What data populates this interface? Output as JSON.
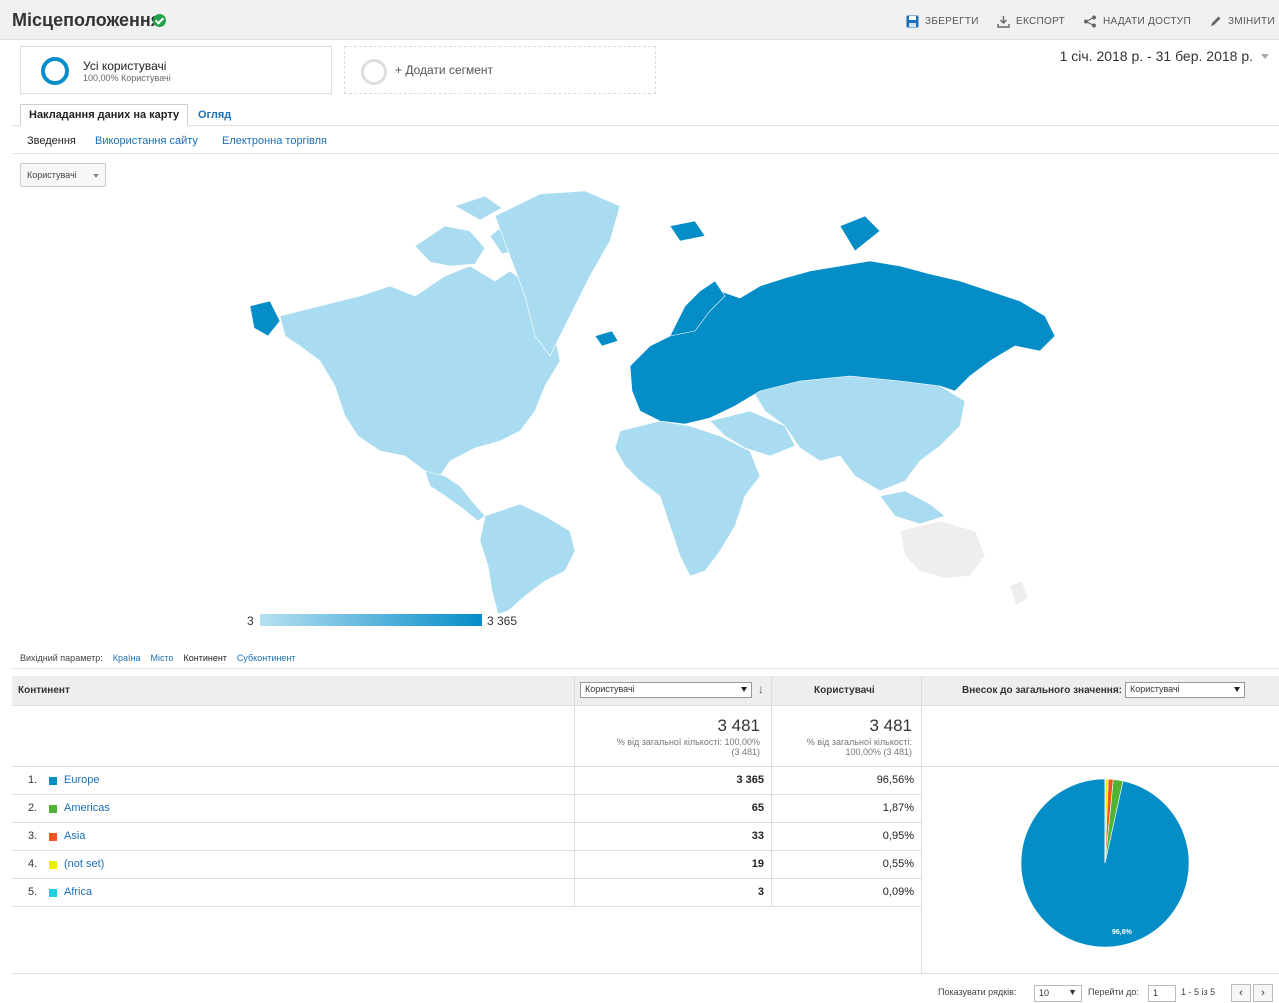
{
  "header": {
    "title": "Місцеположення",
    "save": "ЗБЕРЕГТИ",
    "export": "ЕКСПОРТ",
    "share": "НАДАТИ ДОСТУП",
    "edit": "ЗМІНИТИ"
  },
  "segments": {
    "active_title": "Усі користувачі",
    "active_sub": "100,00% Користувачі",
    "add": "+ Додати сегмент"
  },
  "date_range": "1 січ. 2018 р. - 31 бер. 2018 р.",
  "tabs": {
    "active": "Накладання даних на карту",
    "other": "Огляд"
  },
  "subtabs": [
    "Зведення",
    "Використання сайту",
    "Електронна торгівля"
  ],
  "metric_select": "Користувачі",
  "legend": {
    "min": "3",
    "max": "3 365"
  },
  "primary_dimension": {
    "label": "Вихідний параметр:",
    "options": [
      "Країна",
      "Місто",
      "Континент",
      "Субконтинент"
    ]
  },
  "table": {
    "col_dimension": "Континент",
    "col_metric_select": "Користувачі",
    "col_metric": "Користувачі",
    "col_contribution": "Внесок до загального значення:",
    "col_contribution_select": "Користувачі",
    "total_1": "3 481",
    "total_1_sub1": "% від загальної кількості: 100,00%",
    "total_1_sub2": "(3 481)",
    "total_2": "3 481",
    "total_2_sub1": "% від загальної кількості:",
    "total_2_sub2": "100,00% (3 481)",
    "rows": [
      {
        "num": "1.",
        "label": "Europe",
        "color": "#058dc7",
        "value": "3 365",
        "pct": "96,56%"
      },
      {
        "num": "2.",
        "label": "Americas",
        "color": "#50b432",
        "value": "65",
        "pct": "1,87%"
      },
      {
        "num": "3.",
        "label": "Asia",
        "color": "#ed561b",
        "value": "33",
        "pct": "0,95%"
      },
      {
        "num": "4.",
        "label": "(not set)",
        "color": "#edef00",
        "value": "19",
        "pct": "0,55%"
      },
      {
        "num": "5.",
        "label": "Africa",
        "color": "#24cbe5",
        "value": "3",
        "pct": "0,09%"
      }
    ],
    "pie_label": "96,6%",
    "pie_fractions": [
      0.9656,
      0.0187,
      0.0095,
      0.0055,
      0.0009
    ]
  },
  "pager": {
    "show_rows": "Показувати рядків:",
    "rows_value": "10",
    "goto": "Перейти до:",
    "goto_value": "1",
    "range": "1 - 5 із 5",
    "prev": "‹",
    "next": "›"
  },
  "colors": {
    "accent": "#058dc7",
    "map_light": "#a9dcf0",
    "map_none": "#eeeeee"
  }
}
